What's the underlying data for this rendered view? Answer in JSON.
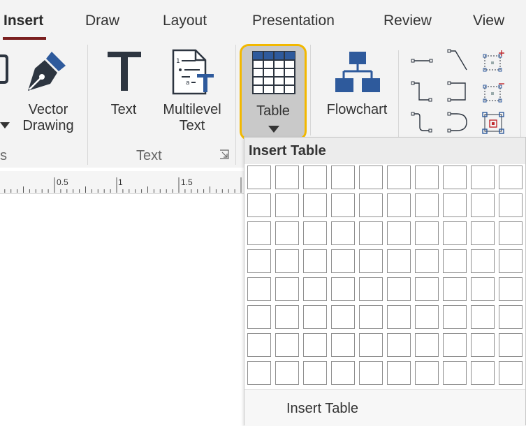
{
  "tabs": [
    {
      "label": "Insert",
      "active": true
    },
    {
      "label": "Draw",
      "active": false
    },
    {
      "label": "Layout",
      "active": false
    },
    {
      "label": "Presentation",
      "active": false
    },
    {
      "label": "Review",
      "active": false
    },
    {
      "label": "View",
      "active": false
    }
  ],
  "ribbon": {
    "vector_drawing": {
      "line1": "Vector",
      "line2": "Drawing"
    },
    "text": {
      "label": "Text"
    },
    "multilevel_text": {
      "line1": "Multilevel",
      "line2": "Text"
    },
    "table": {
      "label": "Table"
    },
    "flowchart": {
      "label": "Flowchart"
    },
    "groups": {
      "left_partial": "s",
      "text": "Text"
    }
  },
  "ruler": {
    "marks": [
      "0.5",
      "1",
      "1.5"
    ]
  },
  "dropdown": {
    "title": "Insert Table",
    "rows": 8,
    "cols": 10,
    "footer": "Insert Table"
  },
  "colors": {
    "accent": "#7a1f1f",
    "highlight": "#f2b800",
    "icon_blue": "#2e5a9c",
    "icon_dark": "#2d3540"
  }
}
